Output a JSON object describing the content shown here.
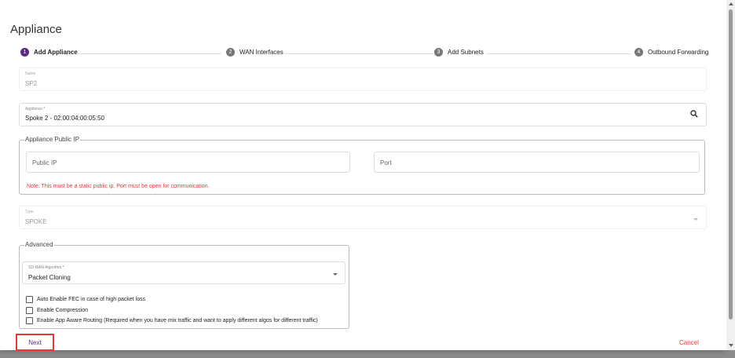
{
  "dialog": {
    "title": "Appliance"
  },
  "stepper": {
    "steps": [
      {
        "num": "1",
        "label": "Add Appliance",
        "active": true
      },
      {
        "num": "2",
        "label": "WAN Interfaces",
        "active": false
      },
      {
        "num": "3",
        "label": "Add Subnets",
        "active": false
      },
      {
        "num": "4",
        "label": "Outbound Forwarding",
        "active": false
      }
    ]
  },
  "form": {
    "name": {
      "label": "Name",
      "value": "SP2"
    },
    "appliance": {
      "label": "Appliance *",
      "value": "Spoke 2 - 02:00:04:00:05:50",
      "icon": "search-icon"
    },
    "public_ip_group": {
      "legend": "Appliance Public IP",
      "public_ip_placeholder": "Public IP",
      "port_placeholder": "Port",
      "note": "Note: This must be a static public ip. Port must be open for communication."
    },
    "type": {
      "label": "Type",
      "value": "SPOKE"
    },
    "advanced": {
      "legend": "Advanced",
      "algorithm": {
        "label": "SD-WAN Algorithm *",
        "value": "Packet Cloning"
      },
      "checkboxes": [
        {
          "label": "Auto Enable FEC in case of high packet loss",
          "checked": false
        },
        {
          "label": "Enable Compression",
          "checked": false
        },
        {
          "label": "Enable App Aware Routing (Required when you have mix traffic and want to apply different algos for different traffic)",
          "checked": false
        }
      ]
    }
  },
  "actions": {
    "next_label": "Next",
    "cancel_label": "Cancel"
  },
  "colors": {
    "accent": "#5b2a80",
    "error": "#e53935"
  }
}
